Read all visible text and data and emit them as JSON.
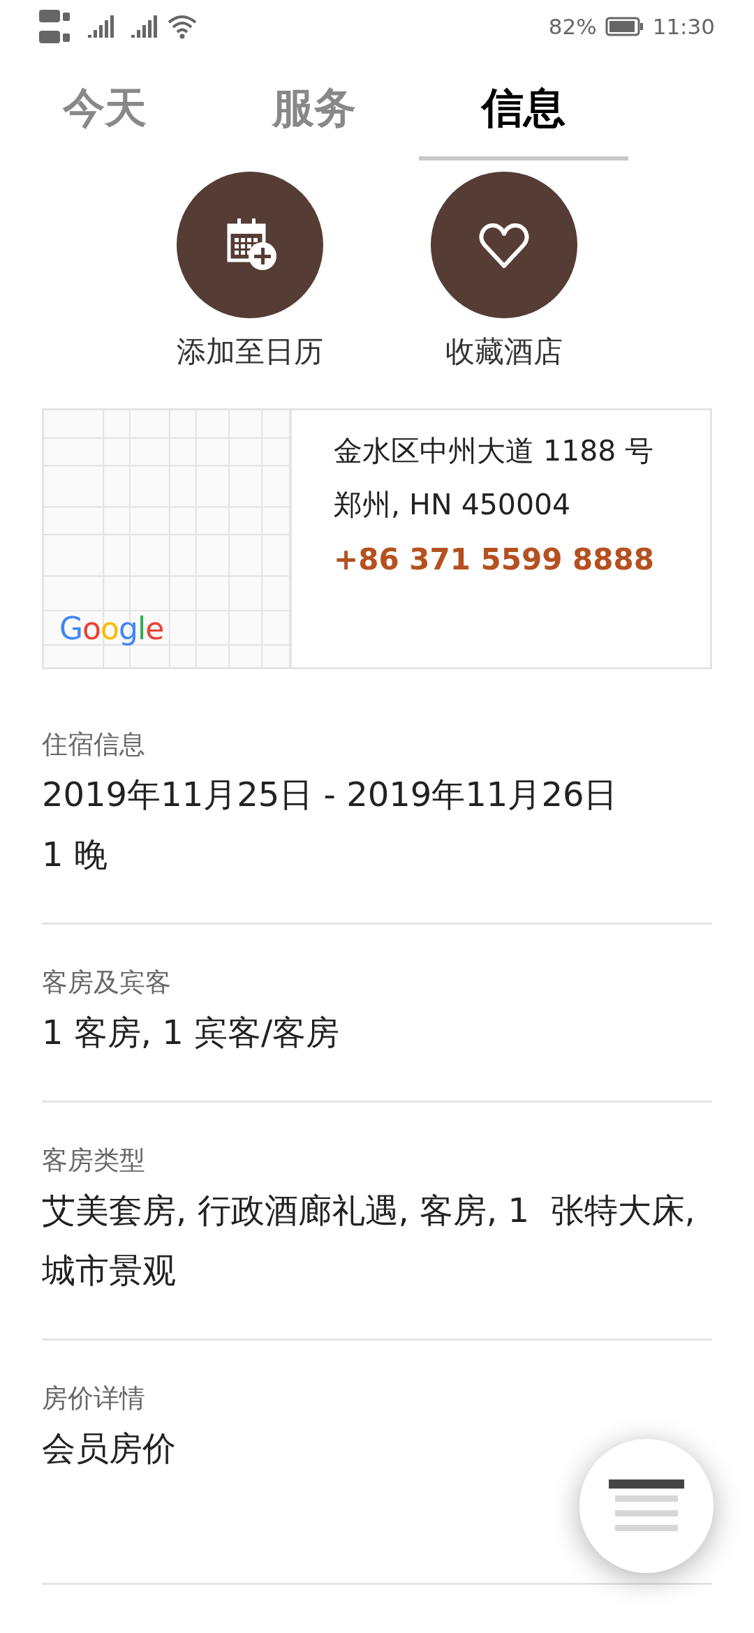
{
  "status_bar": {
    "battery": "82%",
    "time": "11:30"
  },
  "tabs": [
    {
      "label": "今天",
      "selected": false
    },
    {
      "label": "服务",
      "selected": false
    },
    {
      "label": "信息",
      "selected": true
    }
  ],
  "actions": [
    {
      "kind": "calendar",
      "label": "添加至日历"
    },
    {
      "kind": "favorite",
      "label": "收藏酒店"
    }
  ],
  "location": {
    "map": {
      "kind": "picture",
      "attribution": "Google"
    },
    "address_lines": [
      "金水区中州大道 1188 号",
      "郑州, HN 450004"
    ],
    "phone": "+86 371 5599 8888"
  },
  "sections": [
    {
      "label": "住宿信息",
      "lines": [
        "2019年11月25日 - 2019年11月26日",
        "1 晚"
      ]
    },
    {
      "label": "客房及宾客",
      "lines": [
        "1 客房, 1 宾客/客房"
      ]
    },
    {
      "label": "客房类型",
      "lines": [
        "艾美套房, 行政酒廊礼遇, 客房, 1  张特大床, 城市景观"
      ]
    },
    {
      "label": "房价详情",
      "lines": [
        "会员房价"
      ]
    }
  ]
}
